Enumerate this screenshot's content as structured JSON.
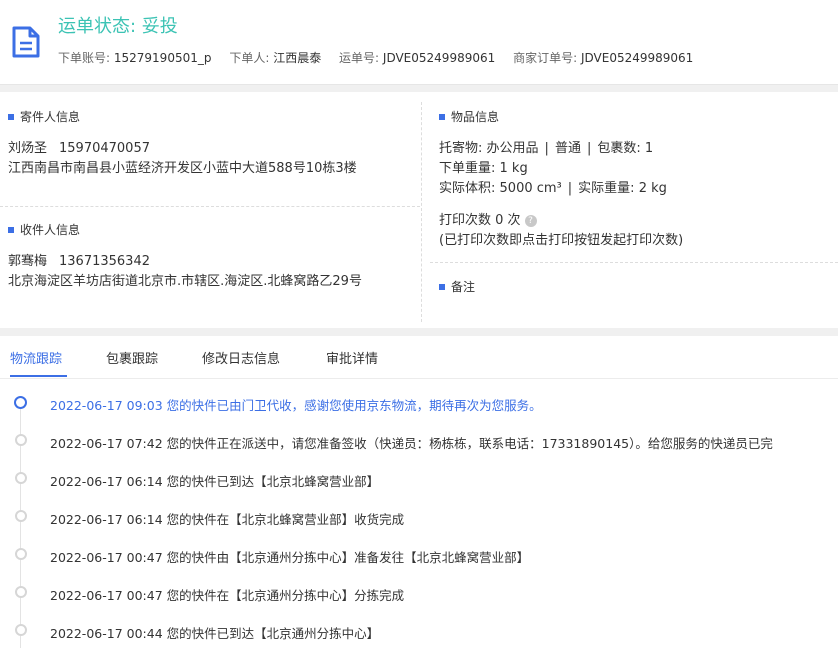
{
  "header": {
    "status_title": "运单状态: 妥投",
    "meta": [
      {
        "label": "下单账号:",
        "value": "15279190501_p"
      },
      {
        "label": "下单人:",
        "value": "江西晨泰"
      },
      {
        "label": "运单号:",
        "value": "JDVE05249989061"
      },
      {
        "label": "商家订单号:",
        "value": "JDVE05249989061"
      }
    ]
  },
  "sender": {
    "title": "寄件人信息",
    "name": "刘炀圣",
    "phone": "15970470057",
    "address": "江西南昌市南昌县小蓝经济开发区小蓝中大道588号10栋3楼"
  },
  "receiver": {
    "title": "收件人信息",
    "name": "郭骞梅",
    "phone": "13671356342",
    "address": "北京海淀区羊坊店街道北京市.市辖区.海淀区.北蜂窝路乙29号"
  },
  "goods": {
    "title": "物品信息",
    "type_label": "托寄物:",
    "type_value": "办公用品",
    "service": "普通",
    "pkg_label": "包裹数:",
    "pkg_value": "1",
    "weight_label": "下单重量:",
    "weight_value": "1 kg",
    "volume_label": "实际体积:",
    "volume_value": "5000 cm³",
    "actual_weight_label": "实际重量:",
    "actual_weight_value": "2 kg",
    "print_label": "打印次数",
    "print_value": "0 次",
    "print_note": "(已打印次数即点击打印按钮发起打印次数)"
  },
  "remarks": {
    "title": "备注"
  },
  "tabs": [
    {
      "label": "物流跟踪",
      "active": true
    },
    {
      "label": "包裹跟踪",
      "active": false
    },
    {
      "label": "修改日志信息",
      "active": false
    },
    {
      "label": "审批详情",
      "active": false
    }
  ],
  "timeline": [
    {
      "text": "2022-06-17 09:03 您的快件已由门卫代收，感谢您使用京东物流，期待再次为您服务。",
      "active": true
    },
    {
      "text": "2022-06-17 07:42 您的快件正在派送中，请您准备签收（快递员：杨栋栋，联系电话：17331890145）。给您服务的快递员已完",
      "active": false
    },
    {
      "text": "2022-06-17 06:14 您的快件已到达【北京北蜂窝营业部】",
      "active": false
    },
    {
      "text": "2022-06-17 06:14 您的快件在【北京北蜂窝营业部】收货完成",
      "active": false
    },
    {
      "text": "2022-06-17 00:47 您的快件由【北京通州分拣中心】准备发往【北京北蜂窝营业部】",
      "active": false
    },
    {
      "text": "2022-06-17 00:47 您的快件在【北京通州分拣中心】分拣完成",
      "active": false
    },
    {
      "text": "2022-06-17 00:44 您的快件已到达【北京通州分拣中心】",
      "active": false
    }
  ],
  "colors": {
    "accent": "#3c6fe5",
    "status": "#3cc3b4"
  }
}
